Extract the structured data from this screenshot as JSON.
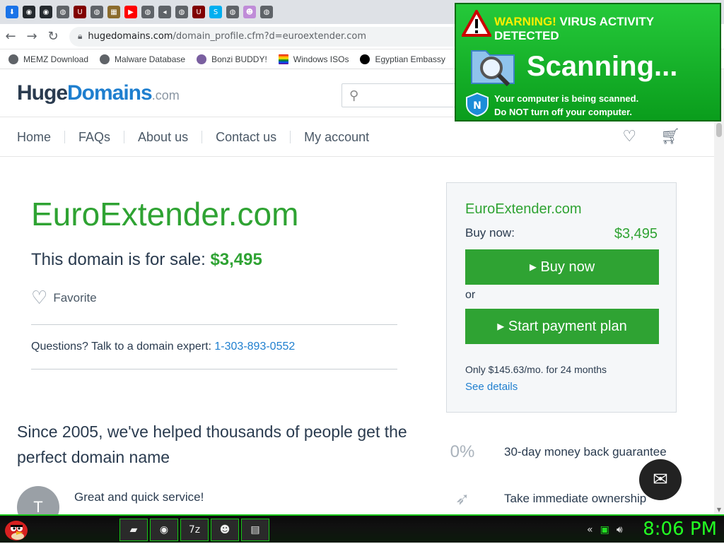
{
  "browser": {
    "tabs": [
      {
        "icon": "download-icon",
        "color": "#1a73e8",
        "glyph": "⬇"
      },
      {
        "icon": "github-icon",
        "color": "#24292e",
        "glyph": "◉"
      },
      {
        "icon": "github-icon",
        "color": "#24292e",
        "glyph": "◉"
      },
      {
        "icon": "globe-icon",
        "color": "#5f6368",
        "glyph": "◍"
      },
      {
        "icon": "ublock-icon",
        "color": "#800000",
        "glyph": "U"
      },
      {
        "icon": "globe-icon",
        "color": "#5f6368",
        "glyph": "◍"
      },
      {
        "icon": "game-icon",
        "color": "#8b6b2c",
        "glyph": "▦"
      },
      {
        "icon": "youtube-icon",
        "color": "#ff0000",
        "glyph": "▶"
      },
      {
        "icon": "globe-icon",
        "color": "#5f6368",
        "glyph": "◍"
      },
      {
        "icon": "speaker-icon",
        "color": "#5f6368",
        "glyph": "◂"
      },
      {
        "icon": "globe-icon",
        "color": "#5f6368",
        "glyph": "◍"
      },
      {
        "icon": "ublock-icon",
        "color": "#800000",
        "glyph": "U"
      },
      {
        "icon": "skype-icon",
        "color": "#00aff0",
        "glyph": "S"
      },
      {
        "icon": "globe-icon",
        "color": "#5f6368",
        "glyph": "◍"
      },
      {
        "icon": "bonzi-icon",
        "color": "#c08cd8",
        "glyph": "☻"
      },
      {
        "icon": "globe-icon",
        "color": "#5f6368",
        "glyph": "◍"
      }
    ],
    "address": {
      "host": "hugedomains.com",
      "path": "/domain_profile.cfm?d=euroextender.com"
    },
    "bookmarks": [
      {
        "icon": "globe-icon",
        "label": "MEMZ Download"
      },
      {
        "icon": "globe-icon",
        "label": "Malware Database"
      },
      {
        "icon": "bonzi-icon",
        "label": "Bonzi BUDDY!"
      },
      {
        "icon": "rainbow-flag-icon",
        "label": "Windows ISOs"
      },
      {
        "icon": "wix-icon",
        "label": "Egyptian Embassy"
      }
    ]
  },
  "site": {
    "logo": {
      "huge": "Huge",
      "domains": "Domains",
      "com": ".com"
    },
    "nav": [
      "Home",
      "FAQs",
      "About us",
      "Contact us",
      "My account"
    ]
  },
  "listing": {
    "domain": "EuroExtender.com",
    "for_sale_prefix": "This domain is for sale: ",
    "price": "$3,495",
    "favorite": "Favorite",
    "questions_prefix": "Questions? Talk to a domain expert: ",
    "phone": "1-303-893-0552",
    "since": "Since 2005, we've helped thousands of people get the perfect domain name",
    "review_avatar": "T",
    "review_title": "Great and quick service!"
  },
  "buybox": {
    "domain": "EuroExtender.com",
    "buy_now_label": "Buy now:",
    "price": "$3,495",
    "buy_button": "▸ Buy now",
    "or": "or",
    "plan_button": "▸ Start payment plan",
    "plan_note": "Only $145.63/mo. for 24 months",
    "see_details": "See details"
  },
  "features": [
    {
      "icon": "zero-percent-icon",
      "glyph": "0%",
      "label": "30-day money back guarantee"
    },
    {
      "icon": "rocket-icon",
      "glyph": "➶",
      "label": "Take immediate ownership"
    }
  ],
  "popup": {
    "warning": "WARNING!",
    "warning_rest": " VIRUS ACTIVITY DETECTED",
    "scanning": "Scanning...",
    "line1": "Your computer is being scanned.",
    "line2_pre": "Do ",
    "line2_not": "NOT",
    "line2_post": " turn off your computer."
  },
  "taskbar": {
    "apps": [
      {
        "icon": "folder-icon",
        "glyph": "▰"
      },
      {
        "icon": "chrome-icon",
        "glyph": "◉"
      },
      {
        "icon": "7zip-icon",
        "glyph": "7z"
      },
      {
        "icon": "bonzi-icon",
        "glyph": "☻"
      },
      {
        "icon": "notepad-icon",
        "glyph": "▤"
      }
    ],
    "clock": "8:06 PM"
  },
  "colors": {
    "brand_green": "#2fa333",
    "link_blue": "#1f7fcf",
    "taskbar_green": "#17c617"
  }
}
